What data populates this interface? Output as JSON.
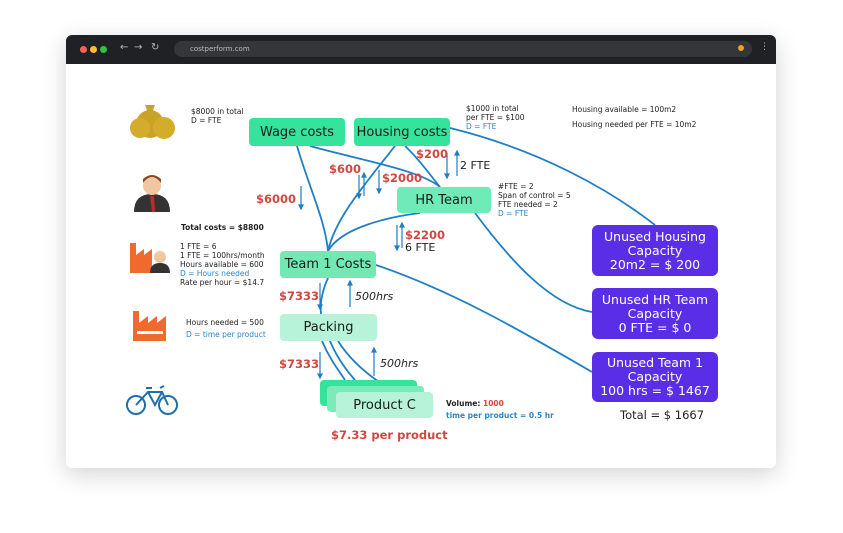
{
  "browser": {
    "url": "costperform.com"
  },
  "nodes": {
    "wage": "Wage costs",
    "housing": "Housing costs",
    "hr": "HR Team",
    "team1": "Team 1 Costs",
    "packing": "Packing",
    "product": "Product C"
  },
  "notes": {
    "wage": [
      "$8000 in total",
      "D = FTE"
    ],
    "housing": [
      "$1000 in total",
      "per FTE = $100",
      "D = FTE"
    ],
    "housing_cap": [
      "Housing available = 100m2",
      "Housing needed per FTE = 10m2"
    ],
    "hr": [
      "#FTE = 2",
      "Span of control = 5",
      "FTE needed = 2",
      "D = FTE"
    ],
    "total_costs": "Total costs = $8800",
    "team1": [
      "1 FTE = 6",
      "1 FTE = 100hrs/month",
      "Hours available = 600",
      "D = Hours needed",
      "Rate per hour = $14.7"
    ],
    "packing": [
      "Hours needed = 500",
      "D = time per product"
    ],
    "volume_label": "Volume:",
    "volume_value": "1000",
    "time_per_product": "time per product = 0.5 hr",
    "per_product": "$7.33 per product"
  },
  "flows": {
    "a6000": "$6000",
    "a600": "$600",
    "a2000": "$2000",
    "a200": "$200",
    "fte2": "2 FTE",
    "a2200": "$2200",
    "fte6": "6 FTE",
    "a7333a": "$7333",
    "hrs500a": "500hrs",
    "a7333b": "$7333",
    "hrs500b": "500hrs"
  },
  "unused": [
    {
      "title": "Unused Housing",
      "line2": "Capacity",
      "line3": "20m2 = $ 200"
    },
    {
      "title": "Unused HR Team",
      "line2": "Capacity",
      "line3": "0 FTE = $ 0"
    },
    {
      "title": "Unused Team 1",
      "line2": "Capacity",
      "line3": "100 hrs = $ 1467"
    }
  ],
  "total": "Total = $ 1667",
  "colors": {
    "node_green": "#35e39c",
    "node_light": "#b6f3d8",
    "unused": "#5a2ee6",
    "flow_line": "#1f7fc4",
    "amount": "#d0473f"
  }
}
